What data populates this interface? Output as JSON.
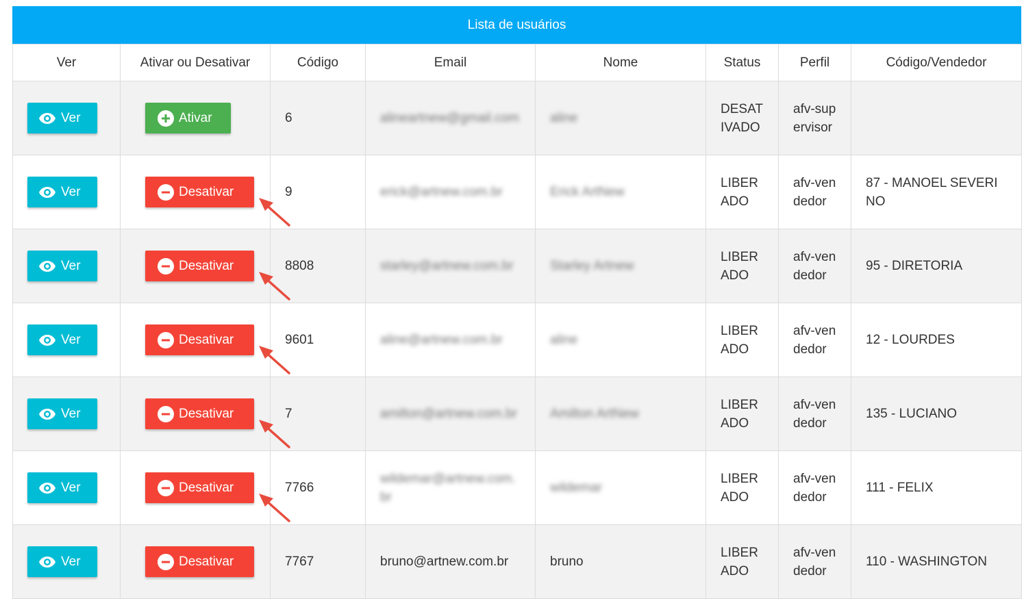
{
  "panel": {
    "title": "Lista de usuários"
  },
  "colors": {
    "header": "#03a9f4",
    "ver_button": "#00bcd4",
    "ativar_button": "#4caf50",
    "desativar_button": "#f44336",
    "annotation_arrow": "#e84c3d"
  },
  "table": {
    "columns": [
      "Ver",
      "Ativar ou Desativar",
      "Código",
      "Email",
      "Nome",
      "Status",
      "Perfil",
      "Código/Vendedor"
    ],
    "rows": [
      {
        "ver_label": "Ver",
        "action_label": "Ativar",
        "action_type": "ativar",
        "codigo": "6",
        "email": "alineartnew@gmail.com",
        "nome": "aline",
        "status": "DESATIVADO",
        "perfil": "afv-supervisor",
        "vendedor": ""
      },
      {
        "ver_label": "Ver",
        "action_label": "Desativar",
        "action_type": "desativar",
        "codigo": "9",
        "email": "erick@artnew.com.br",
        "nome": "Erick ArtNew",
        "status": "LIBERADO",
        "perfil": "afv-vendedor",
        "vendedor": "87 - MANOEL SEVERINO"
      },
      {
        "ver_label": "Ver",
        "action_label": "Desativar",
        "action_type": "desativar",
        "codigo": "8808",
        "email": "starley@artnew.com.br",
        "nome": "Starley Artnew",
        "status": "LIBERADO",
        "perfil": "afv-vendedor",
        "vendedor": "95 - DIRETORIA"
      },
      {
        "ver_label": "Ver",
        "action_label": "Desativar",
        "action_type": "desativar",
        "codigo": "9601",
        "email": "aline@artnew.com.br",
        "nome": "aline",
        "status": "LIBERADO",
        "perfil": "afv-vendedor",
        "vendedor": "12 - LOURDES"
      },
      {
        "ver_label": "Ver",
        "action_label": "Desativar",
        "action_type": "desativar",
        "codigo": "7",
        "email": "amilton@artnew.com.br",
        "nome": "Amilton ArtNew",
        "status": "LIBERADO",
        "perfil": "afv-vendedor",
        "vendedor": "135 - LUCIANO"
      },
      {
        "ver_label": "Ver",
        "action_label": "Desativar",
        "action_type": "desativar",
        "codigo": "7766",
        "email": "wildemar@artnew.com.br",
        "nome": "wildemar",
        "status": "LIBERADO",
        "perfil": "afv-vendedor",
        "vendedor": "111 - FELIX"
      },
      {
        "ver_label": "Ver",
        "action_label": "Desativar",
        "action_type": "desativar",
        "codigo": "7767",
        "email": "bruno@artnew.com.br",
        "nome": "bruno",
        "status": "LIBERADO",
        "perfil": "afv-vendedor",
        "vendedor": "110 - WASHINGTON"
      }
    ]
  }
}
